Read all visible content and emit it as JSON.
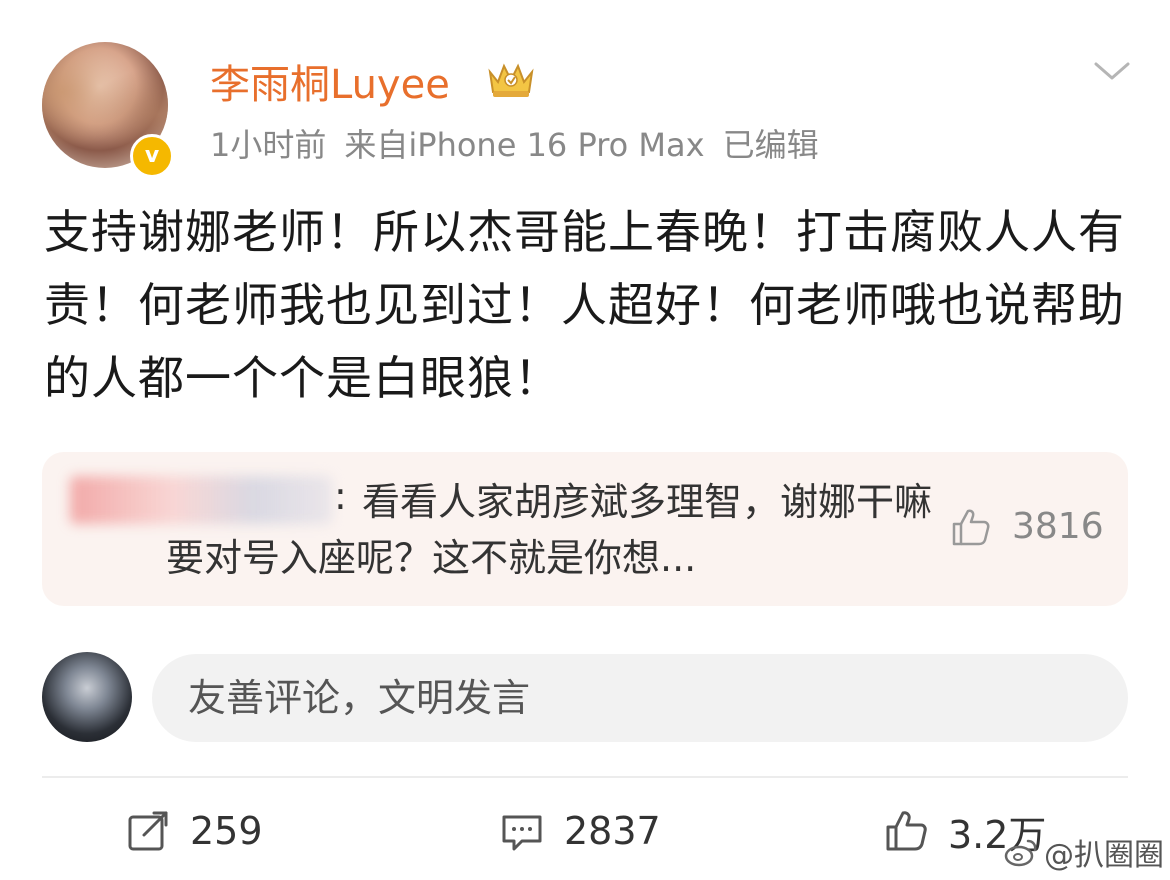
{
  "post": {
    "author": {
      "name": "李雨桐Luyee",
      "verified_mark": "v"
    },
    "meta": {
      "time": "1小时前",
      "source": "来自iPhone 16 Pro Max",
      "edited": "已编辑"
    },
    "text": "支持谢娜老师！所以杰哥能上春晚！打击腐败人人有责！何老师我也见到过！人超好！何老师哦也说帮助的人都一个个是白眼狼！",
    "hot_comment": {
      "text": "看看人家胡彦斌多理智，谢娜干嘛要对号入座呢？这不就是你想...",
      "colon": ":",
      "likes": "3816"
    },
    "comment_box": {
      "placeholder": "友善评论，文明发言"
    },
    "actions": {
      "reposts": "259",
      "comments": "2837",
      "likes": "3.2万"
    }
  },
  "watermark": {
    "text": "@扒圈圈"
  },
  "icons": {
    "menu": "chevron-down-icon",
    "badge": "crown-badge-icon",
    "repost": "repost-icon",
    "comment": "comment-icon",
    "like": "thumbs-up-icon"
  },
  "colors": {
    "username": "#e86f2c",
    "verified": "#f5b800",
    "hot_comment_bg": "#fbf3f0",
    "meta": "#888888"
  }
}
